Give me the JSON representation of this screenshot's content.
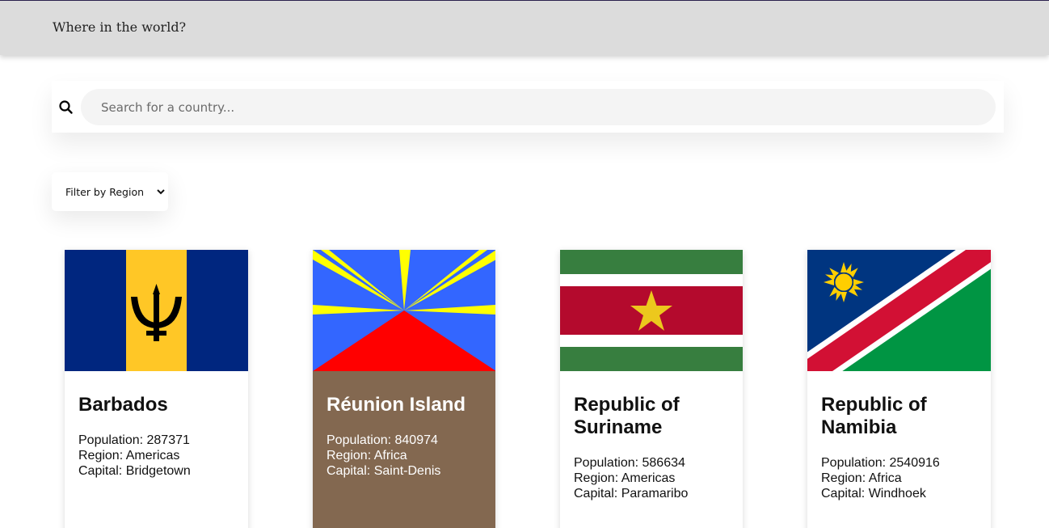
{
  "header": {
    "title": "Where in the world?"
  },
  "search": {
    "placeholder": "Search for a country..."
  },
  "filter": {
    "label": "Filter by Region"
  },
  "colors": {
    "selected_card": "#836850",
    "header_bg": "#dcdcdc"
  },
  "countries": [
    {
      "name": "Barbados",
      "population_label": "Population: 287371",
      "region_label": "Region: Americas",
      "capital_label": "Capital: Bridgetown",
      "flag_icon": "barbados-flag"
    },
    {
      "name": "Réunion Island",
      "population_label": "Population: 840974",
      "region_label": "Region: Africa",
      "capital_label": "Capital: Saint-Denis",
      "flag_icon": "reunion-flag",
      "selected": true
    },
    {
      "name": "Republic of Suriname",
      "population_label": "Population: 586634",
      "region_label": "Region: Americas",
      "capital_label": "Capital: Paramaribo",
      "flag_icon": "suriname-flag"
    },
    {
      "name": "Republic of Namibia",
      "population_label": "Population: 2540916",
      "region_label": "Region: Africa",
      "capital_label": "Capital: Windhoek",
      "flag_icon": "namibia-flag"
    }
  ]
}
